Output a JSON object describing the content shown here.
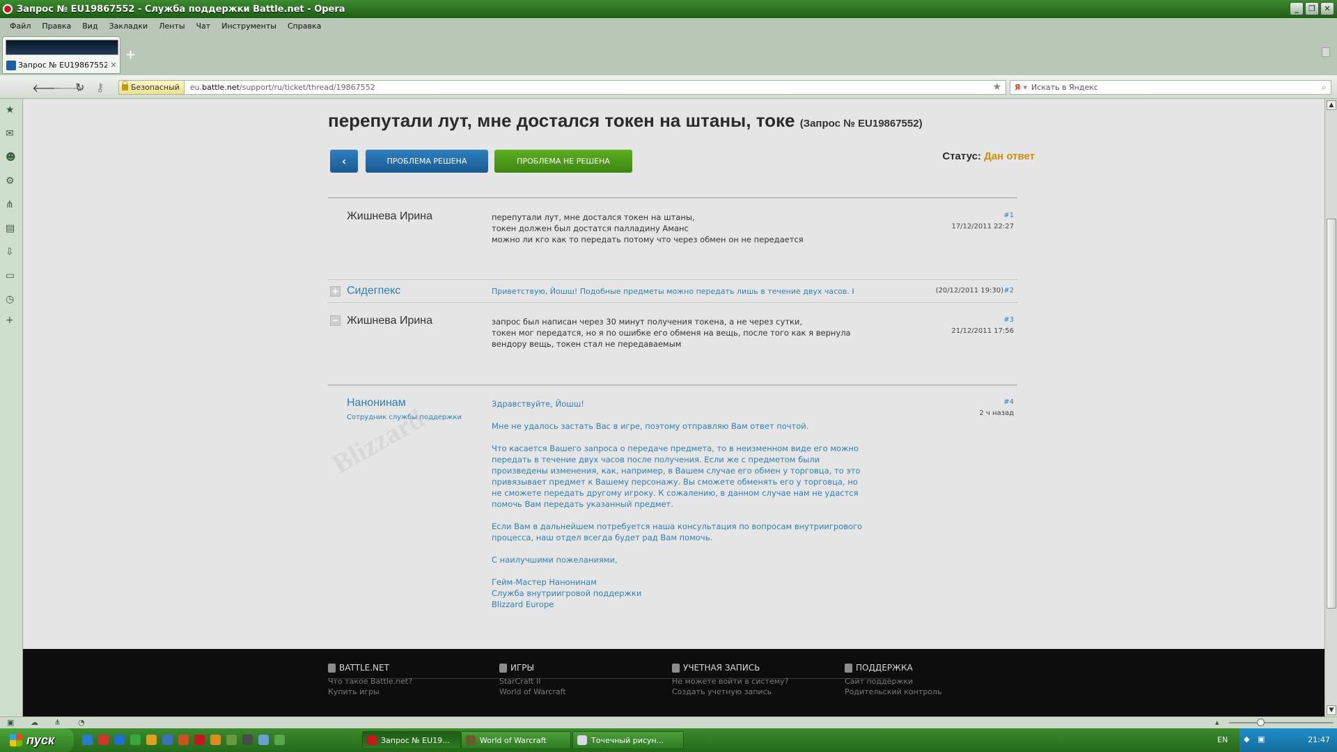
{
  "window": {
    "title": "Запрос № EU19867552 - Служба поддержки Battle.net - Opera",
    "buttons": [
      "_",
      "❐",
      "✕"
    ]
  },
  "menu": [
    "Файл",
    "Правка",
    "Вид",
    "Закладки",
    "Ленты",
    "Чат",
    "Инструменты",
    "Справка"
  ],
  "tab": {
    "label": "Запрос № EU19867552...",
    "close": "×",
    "new_tab": "+"
  },
  "address": {
    "secure_label": "Безопасный",
    "url_prefix": "eu.",
    "url_domain": "battle.net",
    "url_path": "/support/ru/ticket/thread/19867552",
    "search_placeholder": "Искать в Яндекс"
  },
  "ticket": {
    "title": "перепутали лут, мне достался токен на штаны, токе",
    "id_label": "(Запрос № EU19867552)",
    "btn_solved": "ПРОБЛЕМА РЕШЕНА",
    "btn_unsolved": "ПРОБЛЕМА НЕ РЕШЕНА",
    "status_label": "Статус:",
    "status_value": "Дан ответ"
  },
  "posts": [
    {
      "author": "Жишнева Ирина",
      "lines": [
        "перепутали лут, мне достался токен на штаны,",
        "токен должен был достатся палладину Амaнс",
        "можно ли кго как то передать потому что через обмен он не передается"
      ],
      "num": "#1",
      "date": "17/12/2011 22:27"
    },
    {
      "author": "Сидегпекс",
      "toggle": "+",
      "preview": "Приветствую, Йошш! Подобные предметы можно передать лишь в течение двух часов. Как",
      "date": "(20/12/2011 19:30)",
      "num": "#2"
    },
    {
      "author": "Жишнева Ирина",
      "toggle": "−",
      "lines": [
        "запрос был написан через 30 минут получения токена, а не через сутки,",
        "токен мог передатся, но я по ошибке его обменя на вещь, после того как я вернула",
        "вендору вещь, токен стал не передаваемым"
      ],
      "num": "#3",
      "date": "21/12/2011 17:56"
    },
    {
      "author": "Нанонинам",
      "role": "Сотрудник службы поддержки",
      "num": "#4",
      "date": "2 ч назад",
      "paragraphs": [
        "Здравствуйте, Йошш!",
        "Мне не удалось застать Вас в игре, поэтому отправляю Вам ответ почтой.",
        "Что касается Вашего запроса о передаче предмета, то в неизменном виде его можно передать в течение двух часов после получения. Если же с предметом были произведены изменения, как, например, в Вашем случае его обмен у торговца, то это привязывает предмет к Вашему персонажу. Вы сможете обменять его у торговца, но не сможете передать другому игроку. К сожалению, в данном случае нам не удастся помочь Вам передать указанный предмет.",
        "Если Вам в дальнейшем потребуется наша консультация по вопросам внутриигрового процесса, наш отдел всегда будет рад Вам помочь.",
        "С наилучшими пожеланиями,",
        "Гейм-Мастер Нанонинам\nСлужба внутриигровой поддержки\nBlizzard Europe"
      ]
    }
  ],
  "footer": {
    "cols": [
      {
        "title": "BATTLE.NET",
        "links": [
          "Что такое Battle.net?",
          "Купить игры"
        ]
      },
      {
        "title": "ИГРЫ",
        "links": [
          "StarCraft II",
          "World of Warcraft"
        ]
      },
      {
        "title": "УЧЕТНАЯ ЗАПИСЬ",
        "links": [
          "Не можете войти в систему?",
          "Создать учетную запись"
        ]
      },
      {
        "title": "ПОДДЕРЖКА",
        "links": [
          "Сайт поддержки",
          "Родительский контроль"
        ]
      }
    ]
  },
  "taskbar": {
    "start": "пуск",
    "tasks": [
      "Запрос № EU19...",
      "World of Warcraft",
      "Точечный рисун..."
    ],
    "lang": "EN",
    "clock": "21:47"
  },
  "colors": {
    "accent_blue": "#2e7fb6",
    "accent_green": "#5dad1f",
    "status_orange": "#d18d0b"
  }
}
